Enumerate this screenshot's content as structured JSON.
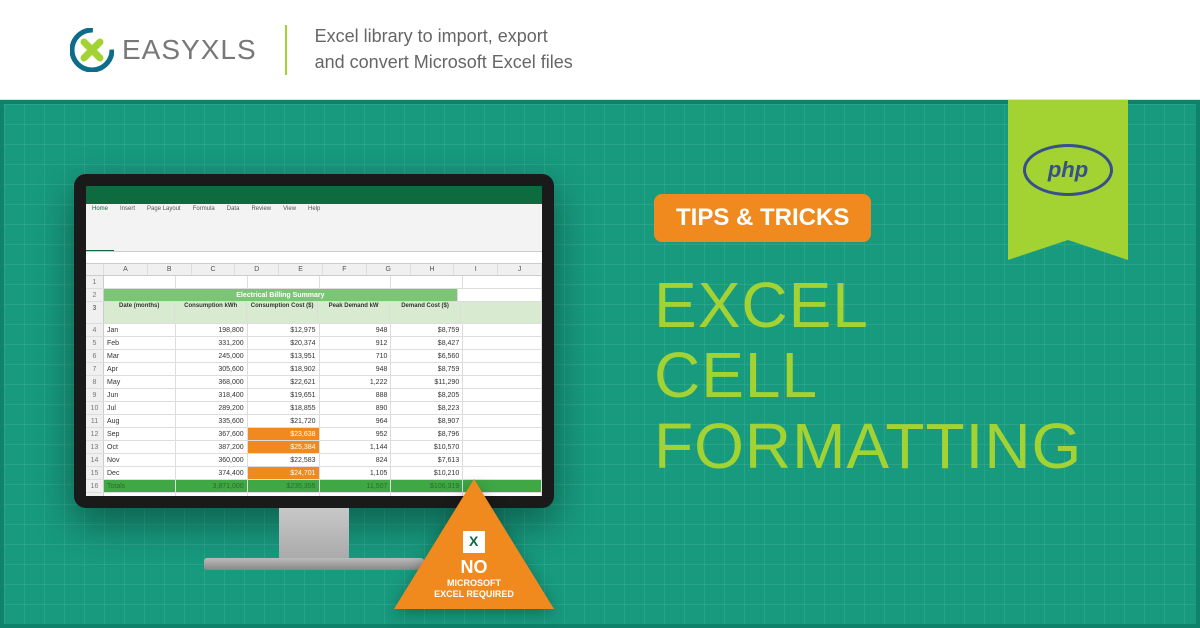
{
  "header": {
    "logo_prefix": "EASY",
    "logo_suffix": "XLS",
    "tagline_l1": "Excel library to import, export",
    "tagline_l2": "and convert Microsoft Excel files",
    "ribbon_tech": "php"
  },
  "hero": {
    "pill": "TIPS & TRICKS",
    "title_l1": "EXCEL",
    "title_l2": "CELL",
    "title_l3": "FORMATTING"
  },
  "badge": {
    "line1": "NO",
    "line2": "MICROSOFT",
    "line3": "EXCEL REQUIRED"
  },
  "excel": {
    "tabs": [
      "Home",
      "Insert",
      "Page Layout",
      "Formula",
      "Data",
      "Review",
      "View",
      "Help"
    ],
    "columns": [
      "A",
      "B",
      "C",
      "D",
      "E",
      "F",
      "G",
      "H",
      "I",
      "J"
    ],
    "sheet_title": "Electrical Billing Summary",
    "headers": [
      "Date (months)",
      "Consumption kWh",
      "Consumption Cost ($)",
      "Peak Demand kW",
      "Demand Cost ($)"
    ],
    "rows": [
      {
        "m": "Jan",
        "c": "198,800",
        "cc": "$12,975",
        "pd": "948",
        "dc": "$8,759",
        "hi": false
      },
      {
        "m": "Feb",
        "c": "331,200",
        "cc": "$20,374",
        "pd": "912",
        "dc": "$8,427",
        "hi": false
      },
      {
        "m": "Mar",
        "c": "245,000",
        "cc": "$13,951",
        "pd": "710",
        "dc": "$6,560",
        "hi": false
      },
      {
        "m": "Apr",
        "c": "305,600",
        "cc": "$18,902",
        "pd": "948",
        "dc": "$8,759",
        "hi": false
      },
      {
        "m": "May",
        "c": "368,000",
        "cc": "$22,621",
        "pd": "1,222",
        "dc": "$11,290",
        "hi": false
      },
      {
        "m": "Jun",
        "c": "318,400",
        "cc": "$19,651",
        "pd": "888",
        "dc": "$8,205",
        "hi": false
      },
      {
        "m": "Jul",
        "c": "289,200",
        "cc": "$18,855",
        "pd": "890",
        "dc": "$8,223",
        "hi": false
      },
      {
        "m": "Aug",
        "c": "335,600",
        "cc": "$21,720",
        "pd": "964",
        "dc": "$8,907",
        "hi": false
      },
      {
        "m": "Sep",
        "c": "367,600",
        "cc": "$23,638",
        "pd": "952",
        "dc": "$8,796",
        "hi": true
      },
      {
        "m": "Oct",
        "c": "387,200",
        "cc": "$25,384",
        "pd": "1,144",
        "dc": "$10,570",
        "hi": true
      },
      {
        "m": "Nov",
        "c": "360,000",
        "cc": "$22,583",
        "pd": "824",
        "dc": "$7,613",
        "hi": false
      },
      {
        "m": "Dec",
        "c": "374,400",
        "cc": "$24,701",
        "pd": "1,105",
        "dc": "$10,210",
        "hi": true
      }
    ],
    "totals": {
      "label": "Totals",
      "c": "3,871,000",
      "cc": "$235,355",
      "pd": "11,507",
      "dc": "$106,319"
    }
  }
}
